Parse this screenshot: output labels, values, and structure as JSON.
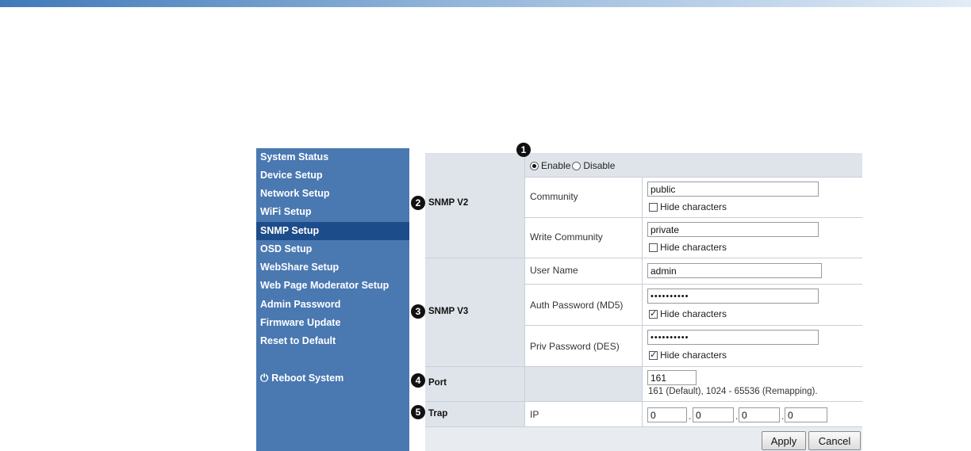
{
  "sidebar": {
    "items": [
      {
        "label": "System Status"
      },
      {
        "label": "Device Setup"
      },
      {
        "label": "Network Setup"
      },
      {
        "label": "WiFi Setup"
      },
      {
        "label": "SNMP Setup",
        "active": true
      },
      {
        "label": "OSD Setup"
      },
      {
        "label": "WebShare Setup"
      },
      {
        "label": "Web Page Moderator Setup"
      },
      {
        "label": "Admin Password"
      },
      {
        "label": "Firmware Update"
      },
      {
        "label": "Reset to Default"
      }
    ],
    "reboot_label": "Reboot System",
    "reboot_icon": "power-icon"
  },
  "callouts": [
    "1",
    "2",
    "3",
    "4",
    "5"
  ],
  "snmp_v2": {
    "section_label": "SNMP V2",
    "enable_label": "Enable",
    "disable_label": "Disable",
    "selected": "Enable",
    "community_label": "Community",
    "community_value": "public",
    "write_community_label": "Write Community",
    "write_community_value": "private",
    "hide_label": "Hide characters"
  },
  "snmp_v3": {
    "section_label": "SNMP V3",
    "user_name_label": "User Name",
    "user_name_value": "admin",
    "auth_label": "Auth Password (MD5)",
    "auth_value": "••••••••••",
    "priv_label": "Priv Password (DES)",
    "priv_value": "••••••••••",
    "hide_label": "Hide characters"
  },
  "port": {
    "section_label": "Port",
    "value": "161",
    "hint": "161 (Default), 1024 - 65536 (Remapping)."
  },
  "trap": {
    "section_label": "Trap",
    "ip_label": "IP",
    "ip": [
      "0",
      "0",
      "0",
      "0"
    ]
  },
  "buttons": {
    "apply": "Apply",
    "cancel": "Cancel"
  }
}
